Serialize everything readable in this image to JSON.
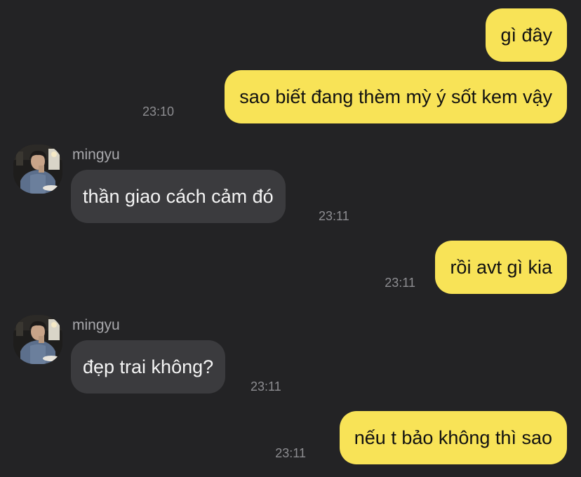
{
  "messages": [
    {
      "from": "me",
      "text": "gì đây",
      "time": ""
    },
    {
      "from": "me",
      "text": "sao biết đang thèm mỳ ý sốt kem vậy",
      "time": "23:10"
    },
    {
      "from": "them",
      "sender": "mingyu",
      "text": "thần giao cách cảm đó",
      "time": "23:11"
    },
    {
      "from": "me",
      "text": "rồi avt gì kia",
      "time": "23:11"
    },
    {
      "from": "them",
      "sender": "mingyu",
      "text": "đẹp trai không?",
      "time": "23:11"
    },
    {
      "from": "me",
      "text": "nếu t bảo không thì sao",
      "time": "23:11"
    }
  ],
  "colors": {
    "background": "#232325",
    "my_bubble": "#f8e357",
    "their_bubble": "#3b3b3e",
    "timestamp": "#8d8d91"
  },
  "icons": [
    "avatar-photo"
  ]
}
